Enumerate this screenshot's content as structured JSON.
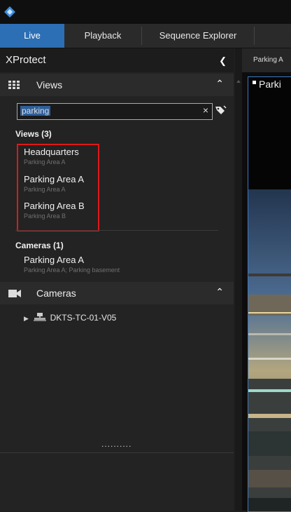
{
  "tabs": [
    {
      "label": "Live",
      "active": true
    },
    {
      "label": "Playback",
      "active": false
    },
    {
      "label": "Sequence Explorer",
      "active": false
    }
  ],
  "panel": {
    "title": "XProtect",
    "collapse_icon": "chevron-left-icon"
  },
  "views_section": {
    "label": "Views",
    "icon": "grid-icon",
    "toggle_icon": "chevron-up-icon"
  },
  "search": {
    "value": "parking",
    "clear": "×"
  },
  "results": {
    "views_header": "Views (3)",
    "views": [
      {
        "name": "Headquarters",
        "sub": "Parking Area A"
      },
      {
        "name": "Parking Area A",
        "sub": "Parking Area A"
      },
      {
        "name": "Parking Area B",
        "sub": "Parking Area B"
      }
    ],
    "cameras_header": "Cameras (1)",
    "cameras": [
      {
        "name": "Parking Area A",
        "sub": "Parking Area A; Parking basement"
      }
    ]
  },
  "cameras_section": {
    "label": "Cameras",
    "icon": "camera-icon",
    "toggle_icon": "chevron-up-icon"
  },
  "tree": {
    "server": "DKTS-TC-01-V05"
  },
  "splitter": "..........",
  "right": {
    "breadcrumb": "Parking A",
    "camera_title": "Parki"
  },
  "colors": {
    "accent": "#2d6fb4",
    "highlight": "#e01818",
    "view_border": "#3a78c2"
  }
}
